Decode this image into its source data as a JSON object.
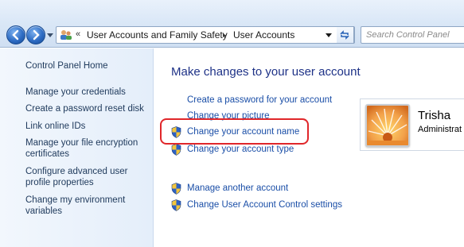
{
  "navigation": {
    "back_icon": "back-arrow-icon",
    "forward_icon": "forward-arrow-icon",
    "history_icon": "chevron-down-icon"
  },
  "address_bar": {
    "overflow_chevron": "«",
    "breadcrumb": [
      "User Accounts and Family Safety",
      "User Accounts"
    ],
    "separator": "▸",
    "refresh_icon": "refresh-icon"
  },
  "search": {
    "placeholder": "Search Control Panel"
  },
  "left_pane": {
    "home": "Control Panel Home",
    "links": [
      "Manage your credentials",
      "Create a password reset disk",
      "Link online IDs",
      "Manage your file encryption certificates",
      "Configure advanced user profile properties",
      "Change my environment variables"
    ]
  },
  "main": {
    "title": "Make changes to your user account",
    "tasks": [
      {
        "label": "Create a password for your account",
        "shield": false
      },
      {
        "label": "Change your picture",
        "shield": false
      },
      {
        "label": "Change your account name",
        "shield": true
      },
      {
        "label": "Change your account type",
        "shield": true
      }
    ],
    "other_tasks": [
      {
        "label": "Manage another account",
        "shield": true
      },
      {
        "label": "Change User Account Control settings",
        "shield": true
      }
    ]
  },
  "user": {
    "name": "Trisha",
    "role": "Administrat"
  },
  "colors": {
    "link": "#1a4ea7",
    "title": "#1e3287",
    "highlight": "#e0262a"
  }
}
